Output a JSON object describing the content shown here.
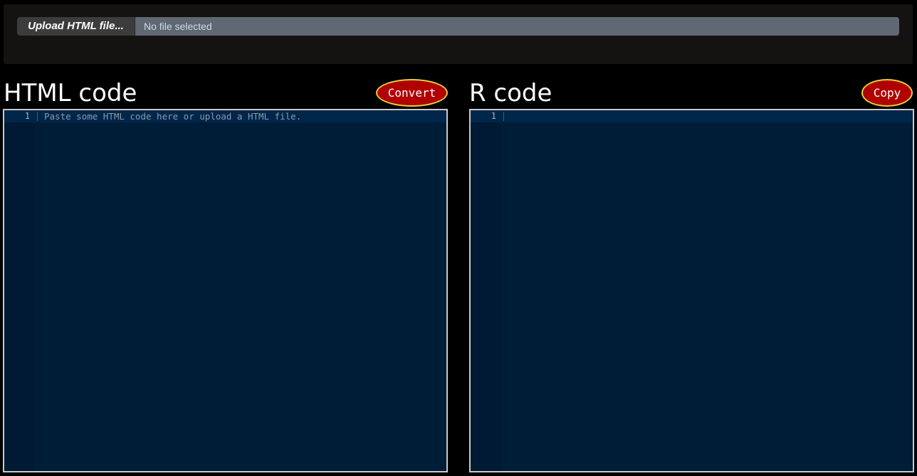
{
  "upload": {
    "button_label": "Upload HTML file...",
    "file_status": "No file selected"
  },
  "html_panel": {
    "title": "HTML code",
    "button_label": "Convert",
    "line_number": "1",
    "placeholder": "Paste some HTML code here or upload a HTML file."
  },
  "r_panel": {
    "title": "R code",
    "button_label": "Copy",
    "line_number": "1",
    "content": ""
  },
  "colors": {
    "page_bg": "#000000",
    "editor_bg": "#001d38",
    "button_red": "#b10000",
    "button_border_yellow": "#e3d23a"
  }
}
